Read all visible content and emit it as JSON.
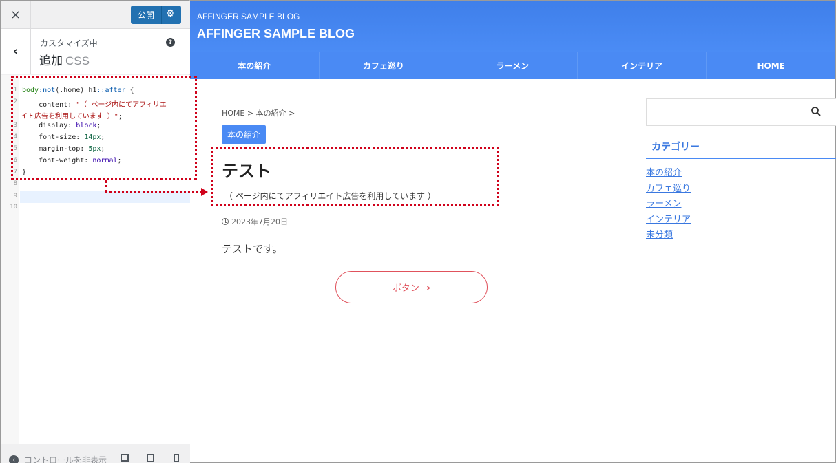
{
  "customizer": {
    "close_icon": "×",
    "publish_label": "公開",
    "gear_icon": "⚙",
    "back_icon": "‹",
    "customizing_label": "カスタマイズ中",
    "section_title": "追加",
    "section_title_suffix": "CSS",
    "help_icon": "?",
    "code_lines": {
      "l1_selector": "body",
      "l1_pseudo1": ":not",
      "l1_arg": "(.home) h1",
      "l1_pseudo2": "::after",
      "l1_brace": " {",
      "l2_prop": "    content: ",
      "l2_str": "\"（ ページ内にてアフィリエ",
      "l3_str": "イト広告を利用しています ）\"",
      "l3_end": ";",
      "l4_prop": "    display: ",
      "l4_val": "block",
      "l5_prop": "    font-size: ",
      "l5_val": "14px",
      "l6_prop": "    margin-top: ",
      "l6_val": "5px",
      "l7_prop": "    font-weight: ",
      "l7_val": "normal",
      "l8_close": "}"
    },
    "line_numbers": [
      "1",
      "2",
      "3",
      "4",
      "5",
      "6",
      "7",
      "8",
      "9",
      "10"
    ],
    "hide_controls_label": "コントロールを非表示",
    "hide_controls_icon": "‹"
  },
  "site": {
    "subtitle": "AFFINGER SAMPLE BLOG",
    "title": "AFFINGER SAMPLE BLOG",
    "nav": [
      "本の紹介",
      "カフェ巡り",
      "ラーメン",
      "インテリア",
      "HOME"
    ],
    "breadcrumb": "HOME > 本の紹介 >",
    "category_badge": "本の紹介",
    "post_title": "テスト",
    "post_note": "（ ページ内にてアフィリエイト広告を利用しています ）",
    "post_date": "2023年7月20日",
    "post_body": "テストです。",
    "button_label": "ボタン",
    "button_chevron": "›",
    "sidebar_heading": "カテゴリー",
    "categories": [
      "本の紹介",
      "カフェ巡り",
      "ラーメン",
      "インテリア",
      "未分類"
    ]
  },
  "colors": {
    "accent": "#4a8af4",
    "publish": "#2271b1",
    "annotation": "#d0021b",
    "button": "#e0525c"
  }
}
